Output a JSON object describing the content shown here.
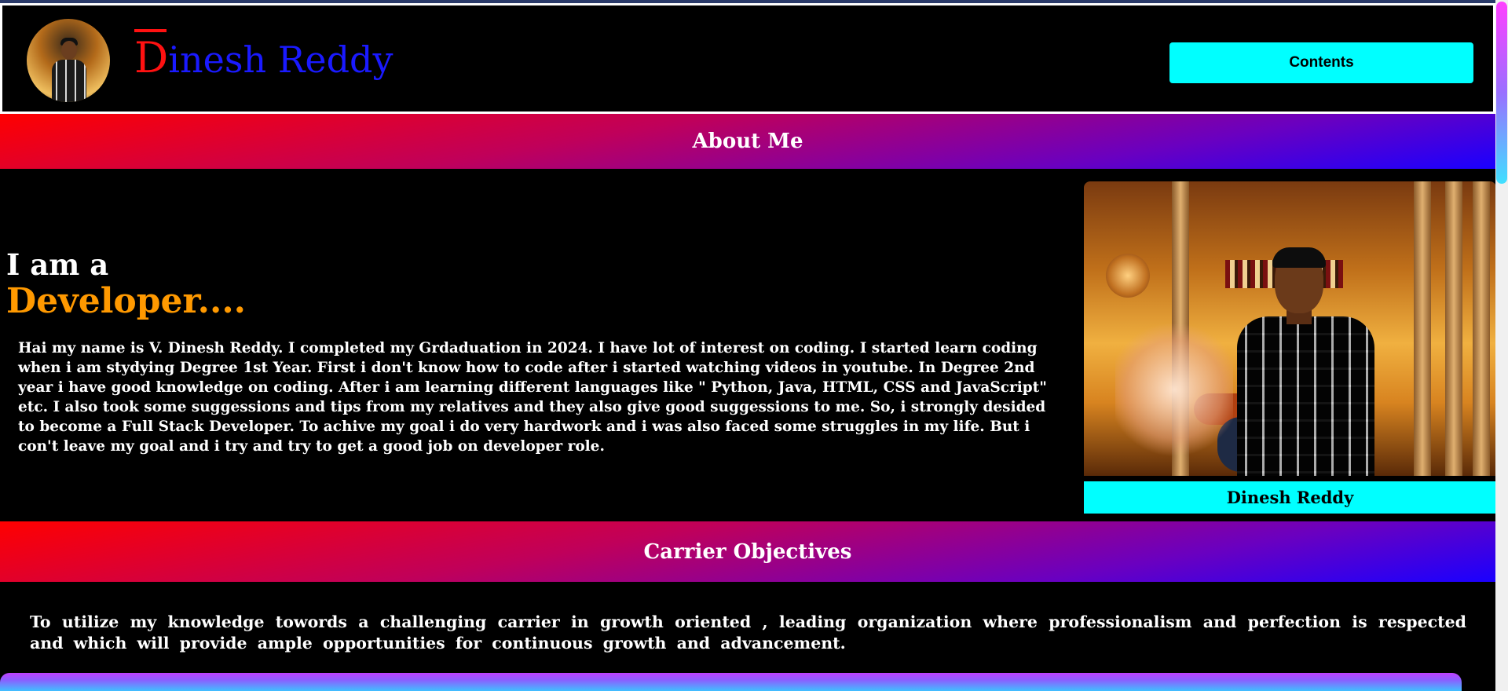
{
  "header": {
    "brand_first": "D",
    "brand_rest": "inesh Reddy",
    "contents_label": "Contents"
  },
  "about": {
    "heading": "About Me",
    "intro_line1": "I am a",
    "intro_line2": "Developer....",
    "paragraph": "Hai my name is V. Dinesh Reddy. I completed my Grdaduation in 2024. I have lot of interest on coding. I started learn coding when i am stydying Degree 1st Year. First i don't know how to code after i started watching videos in youtube. In Degree 2nd year i have good knowledge on coding. After i am learning different languages like \" Python, Java, HTML, CSS and JavaScript\" etc. I also took some suggessions and tips from my relatives and they also give good suggessions to me. So, i strongly desided to become a Full Stack Developer. To achive my goal i do very hardwork and i was also faced some struggles in my life. But i con't leave my goal and i try and try to get a good job on developer role.",
    "photo_caption": "Dinesh Reddy"
  },
  "carrier": {
    "heading": "Carrier Objectives",
    "paragraph": "To utilize my knowledge towords a challenging carrier in growth oriented , leading organization where professionalism and perfection is respected and which will provide ample opportunities for continuous growth and advancement."
  },
  "colors": {
    "accent_cyan": "#00ffff",
    "brand_red": "#ff1111",
    "brand_blue": "#1a1aff",
    "highlight_orange": "#ff9900"
  }
}
